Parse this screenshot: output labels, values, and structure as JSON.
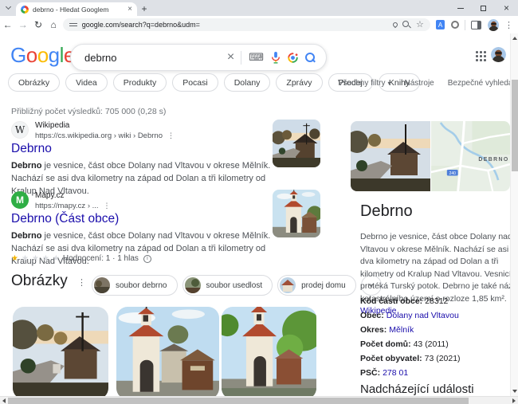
{
  "colors": {
    "accent_blue": "#4285f4",
    "logo_red": "#ea4335",
    "logo_yellow": "#fbbc05",
    "logo_green": "#34a853",
    "link": "#1a0dab",
    "text": "#202124",
    "muted_gray": "#5f6368",
    "snippet_gray": "#4d5156",
    "chip_border": "#dadce0",
    "star_active": "#f4b400",
    "road_badge_blue": "#4285f4",
    "tabbar_bg": "#dee1e6",
    "mapycz_green": "#2fae45"
  },
  "icons": {
    "star": "★",
    "star_outline": "☆",
    "more_vertical": "⋮",
    "close": "×",
    "plus": "+",
    "back": "←",
    "forward": "→",
    "reload": "↻",
    "home": "⌂",
    "keyboard": "⌨",
    "caret_down": "▾",
    "chevron_down": "⌄",
    "translate_letter": "A",
    "info_letter": "i"
  },
  "browser": {
    "tab_title": "debrno - Hledat Googlem",
    "url": "google.com/search?q=debrno&udm="
  },
  "search_header": {
    "logo_letters": [
      "G",
      "o",
      "o",
      "g",
      "l",
      "e"
    ],
    "query": "debrno"
  },
  "filter_bar": {
    "chips": [
      "Obrázky",
      "Videa",
      "Produkty",
      "Pocasi",
      "Dolany",
      "Zprávy",
      "Prodej",
      "Knihy"
    ],
    "all_filters": "Všechny filtry",
    "tools": "Nástroje",
    "safe_search": "Bezpečné vyhledávání"
  },
  "results": {
    "stats": "Přibližný počet výsledků: 705 000 (0,28 s)",
    "items": [
      {
        "source": "Wikipedia",
        "favicon": "W",
        "breadcrumb": "https://cs.wikipedia.org › wiki › Debrno",
        "title": "Debrno",
        "snippet_bold": "Debrno",
        "snippet_rest": " je vesnice, část obce Dolany nad Vltavou v okrese Mělník. Nachází se asi dva kilometry na západ od Dolan a tři kilometry od Kralup Nad Vltavou."
      },
      {
        "source": "Mapy.cz",
        "favicon": "M",
        "breadcrumb": "https://mapy.cz › ...",
        "title": "Debrno (Část obce)",
        "snippet_bold": "Debrno",
        "snippet_rest": " je vesnice, část obce Dolany nad Vltavou v okrese Mělník. Nachází se asi dva kilometry na západ od Dolan a tři kilometry od Kralup Nad Vltavou.",
        "rating_text": "Hodnocení: 1 ·  1 hlas"
      }
    ]
  },
  "images_section": {
    "title": "Obrázky",
    "chips": [
      "soubor debrno",
      "soubor usedlost",
      "prodej domu"
    ]
  },
  "knowledge_panel": {
    "map_label": "DEBRNO",
    "road_badge": "240",
    "title": "Debrno",
    "description": "Debrno je vesnice, část obce Dolany nad Vltavou v okrese Mělník. Nachází se asi dva kilometry na západ od Dolan a tři kilometry od Kralup Nad Vltavou. Vesnicí protéká Turský potok. Debrno je také název katastrálního území o rozloze 1,85 km².",
    "wikipedia_link": "Wikipedie",
    "facts": [
      {
        "label": "Kód části obce:",
        "value": "28312"
      },
      {
        "label": "Obec:",
        "value": "Dolany nad Vltavou"
      },
      {
        "label": "Okres:",
        "value": "Mělník"
      },
      {
        "label": "Počet domů:",
        "value": "43 (2011)"
      },
      {
        "label": "Počet obyvatel:",
        "value": "73 (2021)"
      },
      {
        "label": "PSČ:",
        "value": "278 01"
      }
    ],
    "events_title": "Nadcházející události"
  }
}
